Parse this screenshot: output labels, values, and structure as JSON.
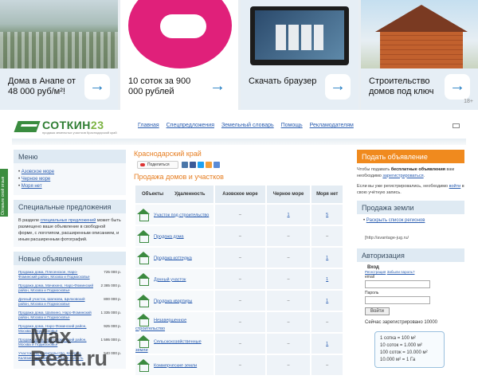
{
  "ads": [
    {
      "caption": "Дома в Анапе от 48 000 руб/м²!",
      "arrow": "→"
    },
    {
      "caption": "10 соток за 900 000 рублей",
      "arrow": "→",
      "brand_color": "#e0207a"
    },
    {
      "caption": "Скачать браузер",
      "arrow": "→"
    },
    {
      "caption": "Строительство домов под ключ",
      "arrow": "→",
      "age_badge": "18+"
    }
  ],
  "header": {
    "logo": "СОТКИН",
    "logo_num": "23",
    "logo_sub": "продажа земельных участков Краснодарский край",
    "nav": [
      "Главная",
      "Спецпредложения",
      "Земельный словарь",
      "Помощь",
      "Рекламодателям"
    ]
  },
  "side_tab": "Оставьте свой отзыв",
  "left": {
    "menu_title": "Меню",
    "menu": [
      "Азовское море",
      "Черное море",
      "Моря нет"
    ],
    "spec_title": "Специальные предложения",
    "spec_pre": "В разделе ",
    "spec_link": "специальных предложений",
    "spec_post": " может быть размещено ваше объявление в свободной форме, с логотипом, расширенным описанием, и иным расширенным фотографий.",
    "new_title": "Новые объявления",
    "listings": [
      {
        "title": "Продажа дома, Плесенское, Наро-Фоминский район, Москва и Подмосковье",
        "price": "725 000 р."
      },
      {
        "title": "Продажа дома, Мачихино, Наро-Фоминский район, Москва и Подмосковье",
        "price": "2 385 000 р."
      },
      {
        "title": "Дачный участок, Шапкова, Щелковский район, Москва и Подмосковье",
        "price": "800 000 р."
      },
      {
        "title": "Продажа дома, Шапкино, Наро-Фоминский район, Москва и Подмосковье",
        "price": "1 335 000 р."
      },
      {
        "title": "Продажа дома, Наро-Фоминский район, Москва и Подмосковье",
        "price": "925 000 р."
      },
      {
        "title": "Продажа дома, Наро-Фоминский район, Москва и Подмосковье",
        "price": "1 595 000 р."
      },
      {
        "title": "Участок под строительство, Калязин, Калязинский район, Тверская область",
        "price": "540 000 р."
      }
    ]
  },
  "center": {
    "region": "Краснодарский край",
    "share_label": "Поделиться",
    "sale_title": "Продажа домов и участков",
    "columns": [
      "Объекты",
      "Удаленность",
      "Азовское море",
      "Черное море",
      "Моря нет"
    ],
    "rows": [
      {
        "name": "Участок под строительство",
        "azov": "–",
        "black": "1",
        "none": "5"
      },
      {
        "name": "Продажа дома",
        "azov": "–",
        "black": "–",
        "none": "–"
      },
      {
        "name": "Продажа коттеджа",
        "azov": "–",
        "black": "–",
        "none": "1"
      },
      {
        "name": "Дачный участок",
        "azov": "–",
        "black": "–",
        "none": "1"
      },
      {
        "name": "Продажа квартиры",
        "azov": "–",
        "black": "–",
        "none": "1"
      },
      {
        "name": "Незавершенное строительство",
        "azov": "–",
        "black": "–",
        "none": "–"
      },
      {
        "name": "Сельскохозяйственные земли",
        "azov": "–",
        "black": "–",
        "none": "1"
      },
      {
        "name": "Коммерческие земли",
        "azov": "–",
        "black": "–",
        "none": "–"
      }
    ]
  },
  "right": {
    "post_btn": "Подать объявление",
    "post_pre": "Чтобы подавать ",
    "post_bold": "бесплатные объявления",
    "post_mid": " вам необходимо ",
    "post_link": "зарегистрироваться",
    "post_end": ".",
    "reg_pre": "Если вы уже регистрировались, необходимо ",
    "reg_link": "войти",
    "reg_end": " в свою учётную запись.",
    "sale_title": "Продажа земли",
    "expand_link": "Раскрыть список регионов",
    "image_alt": "[http://avantage-jug.ru/",
    "auth_title": "Авторизация",
    "login_title": "Вход",
    "register_link": "Регистрация",
    "forgot_link": "Забыли пароль?",
    "email_label": "email",
    "password_label": "Пароль",
    "enter_btn": "Войти",
    "registered": "Сейчас зарегистрировано 10000",
    "conversions": [
      "1 сотка = 100 м²",
      "10 соток = 1.000 м²",
      "100 соток = 10.000 м²",
      "10.000 м² = 1 Га"
    ]
  },
  "watermark": {
    "line1": "Max",
    "line2": "Realt.ru"
  }
}
